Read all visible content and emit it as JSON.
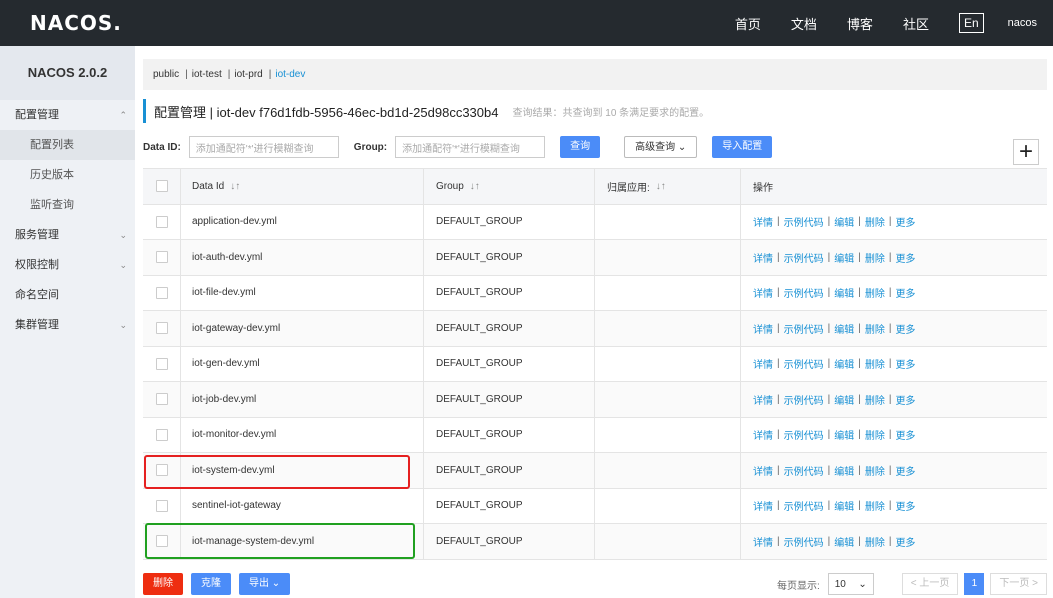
{
  "topbar": {
    "logo": "NACOS.",
    "nav": [
      "首页",
      "文档",
      "博客",
      "社区"
    ],
    "lang": "En",
    "user": "nacos"
  },
  "sidebar": {
    "version": "NACOS 2.0.2",
    "items": [
      {
        "label": "配置管理",
        "chev": "^"
      },
      {
        "label": "配置列表"
      },
      {
        "label": "历史版本"
      },
      {
        "label": "监听查询"
      },
      {
        "label": "服务管理",
        "chev": "v"
      },
      {
        "label": "权限控制",
        "chev": "v"
      },
      {
        "label": "命名空间"
      },
      {
        "label": "集群管理",
        "chev": "v"
      }
    ]
  },
  "namespaces": [
    "public",
    "iot-test",
    "iot-prd",
    "iot-dev"
  ],
  "title": {
    "main": "配置管理 | iot-dev  f76d1fdb-5956-46ec-bd1d-25d98cc330b4",
    "result": "查询结果：共查询到 10 条满足要求的配置。"
  },
  "filters": {
    "dataid_label": "Data ID:",
    "dataid_placeholder": "添加通配符'*'进行模糊查询",
    "group_label": "Group:",
    "group_placeholder": "添加通配符'*'进行模糊查询",
    "query": "查询",
    "advanced": "高级查询",
    "import": "导入配置",
    "plus": "+"
  },
  "table": {
    "headers": [
      "Data Id",
      "Group",
      "归属应用:",
      "操作"
    ],
    "ops": [
      "详情",
      "示例代码",
      "编辑",
      "删除",
      "更多"
    ],
    "rows": [
      {
        "id": "application-dev.yml",
        "group": "DEFAULT_GROUP"
      },
      {
        "id": "iot-auth-dev.yml",
        "group": "DEFAULT_GROUP"
      },
      {
        "id": "iot-file-dev.yml",
        "group": "DEFAULT_GROUP"
      },
      {
        "id": "iot-gateway-dev.yml",
        "group": "DEFAULT_GROUP"
      },
      {
        "id": "iot-gen-dev.yml",
        "group": "DEFAULT_GROUP"
      },
      {
        "id": "iot-job-dev.yml",
        "group": "DEFAULT_GROUP"
      },
      {
        "id": "iot-monitor-dev.yml",
        "group": "DEFAULT_GROUP"
      },
      {
        "id": "iot-system-dev.yml",
        "group": "DEFAULT_GROUP"
      },
      {
        "id": "sentinel-iot-gateway",
        "group": "DEFAULT_GROUP"
      },
      {
        "id": "iot-manage-system-dev.yml",
        "group": "DEFAULT_GROUP"
      }
    ]
  },
  "footer": {
    "delete": "删除",
    "clone": "克隆",
    "export": "导出",
    "page_size_label": "每页显示:",
    "page_size": "10",
    "prev": "< 上一页",
    "page": "1",
    "next": "下一页 >"
  },
  "colors": {
    "accent": "#4b8cf8",
    "danger": "#ee2d10",
    "link": "#1890d4",
    "highlight_red": "#e52020",
    "highlight_green": "#20a020"
  }
}
